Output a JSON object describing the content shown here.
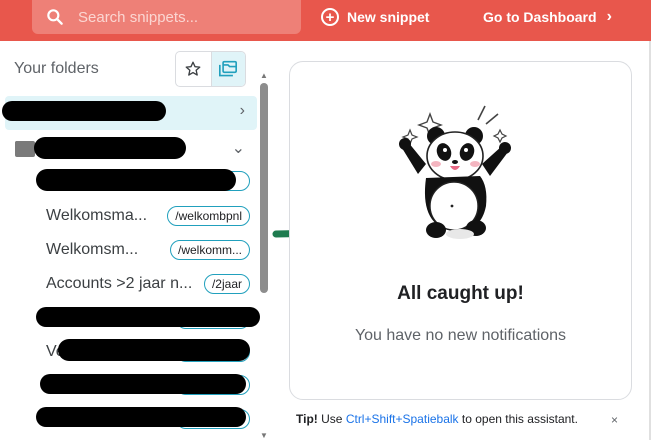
{
  "header": {
    "search_placeholder": "Search snippets...",
    "new_snippet_label": "New snippet",
    "new_snippet_icon": "plus-circle-icon",
    "dashboard_label": "Go to Dashboard",
    "dashboard_icon": "chevron-right-icon",
    "search_icon": "search-icon"
  },
  "sidebar": {
    "title": "Your folders",
    "toggle": {
      "favorites_icon": "star-icon",
      "folders_icon": "folders-icon",
      "active": "folders"
    },
    "folders": [
      {
        "label": "",
        "chevron": "›",
        "selected": true,
        "color": "#21a0bd"
      },
      {
        "label": "",
        "chevron": "⌄",
        "selected": false,
        "color": "#7a7a7a"
      }
    ],
    "snippets": [
      {
        "name": "",
        "shortcut": ""
      },
      {
        "name": "Welkomsma...",
        "shortcut": "/welkombpnl"
      },
      {
        "name": "Welkomsm...",
        "shortcut": "/welkomm..."
      },
      {
        "name": "Accounts >2 jaar n...",
        "shortcut": "/2jaar"
      },
      {
        "name": "",
        "shortcut": ""
      },
      {
        "name": "Ve",
        "shortcut": ""
      },
      {
        "name": "",
        "shortcut": ""
      },
      {
        "name": "",
        "shortcut": ""
      }
    ]
  },
  "notifications": {
    "title": "All caught up!",
    "subtitle": "You have no new notifications",
    "illustration": "panda-celebrating-icon"
  },
  "footer": {
    "tip_prefix": "Tip!",
    "tip_use": "Use",
    "tip_keys": "Ctrl+Shift+Spatiebalk",
    "tip_suffix": "to open this assistant.",
    "close": "×"
  },
  "colors": {
    "header_bg": "#e8574c",
    "accent": "#21a0bd",
    "selected_bg": "#e0f4f8",
    "arrow": "#1e7b4f"
  }
}
